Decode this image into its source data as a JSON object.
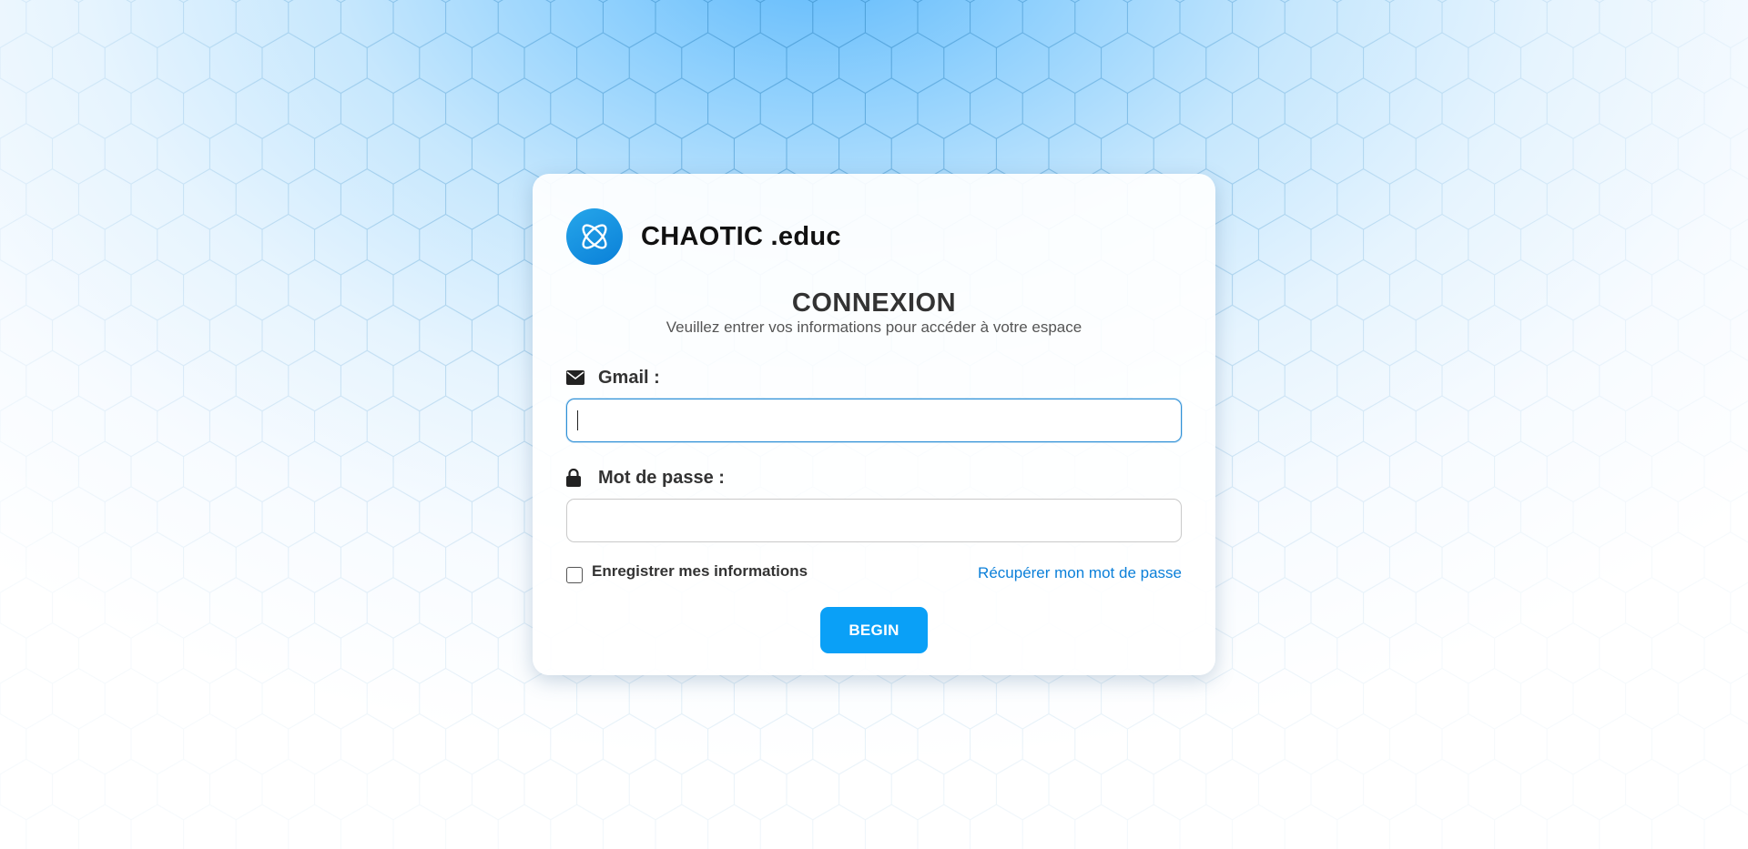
{
  "brand": {
    "name": "CHAOTIC .educ",
    "logo_icon": "atom-icon",
    "accent_color": "#0a80d8"
  },
  "login": {
    "heading": "CONNEXION",
    "subheading": "Veuillez entrer vos informations pour accéder à votre espace",
    "email": {
      "icon": "envelope-icon",
      "label": "Gmail :",
      "value": "",
      "focused": true
    },
    "password": {
      "icon": "lock-icon",
      "label": "Mot de passe :",
      "value": ""
    },
    "remember": {
      "label": "Enregistrer mes informations",
      "checked": false
    },
    "forgot_link": "Récupérer mon mot de passe",
    "submit_label": "BEGIN",
    "submit_color": "#0aa0f7"
  }
}
